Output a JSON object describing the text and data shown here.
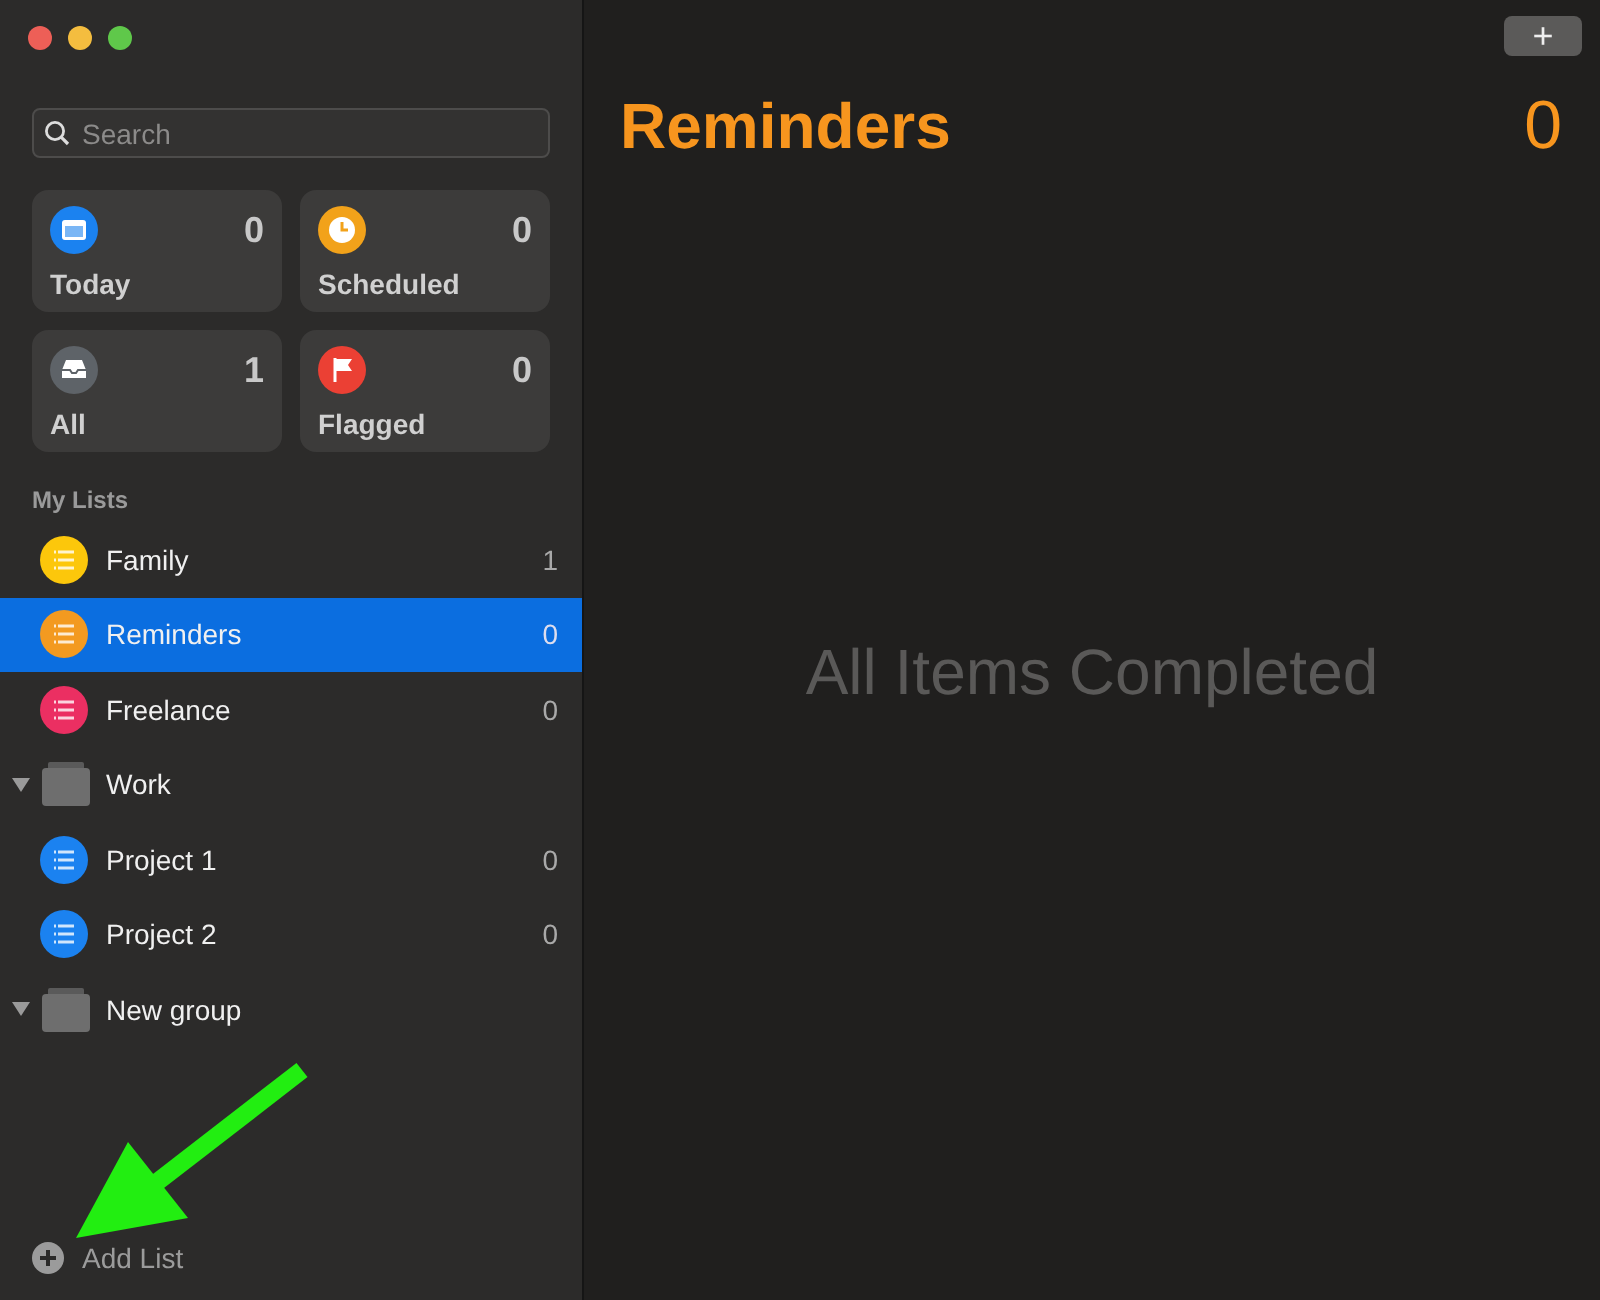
{
  "window": {
    "traffic_lights": [
      {
        "color": "#ed5f57"
      },
      {
        "color": "#f4bd3f"
      },
      {
        "color": "#5fc84a"
      }
    ]
  },
  "sidebar": {
    "search": {
      "placeholder": "Search"
    },
    "smart_lists": [
      {
        "kind": "today",
        "label": "Today",
        "count": "0",
        "color": "#1b82f0"
      },
      {
        "kind": "scheduled",
        "label": "Scheduled",
        "count": "0",
        "color": "#f2a21a"
      },
      {
        "kind": "all",
        "label": "All",
        "count": "1",
        "color": "#5e6368"
      },
      {
        "kind": "flagged",
        "label": "Flagged",
        "count": "0",
        "color": "#eb4034"
      }
    ],
    "section_title": "My Lists",
    "items": [
      {
        "kind": "list",
        "name": "Family",
        "count": "1",
        "color": "#fcc70b",
        "selected": false
      },
      {
        "kind": "list",
        "name": "Reminders",
        "count": "0",
        "color": "#f39a20",
        "selected": true
      },
      {
        "kind": "list",
        "name": "Freelance",
        "count": "0",
        "color": "#eb2f62",
        "selected": false
      },
      {
        "kind": "group",
        "name": "Work",
        "expanded": true,
        "children": [
          {
            "kind": "list",
            "name": "Project 1",
            "count": "0",
            "color": "#1b82f0",
            "selected": false
          },
          {
            "kind": "list",
            "name": "Project 2",
            "count": "0",
            "color": "#1b82f0",
            "selected": false
          }
        ]
      },
      {
        "kind": "group",
        "name": "New group",
        "expanded": true
      }
    ],
    "add_list": "Add List"
  },
  "main": {
    "add_button": "+",
    "title": "Reminders",
    "count": "0",
    "empty_message": "All Items Completed"
  }
}
